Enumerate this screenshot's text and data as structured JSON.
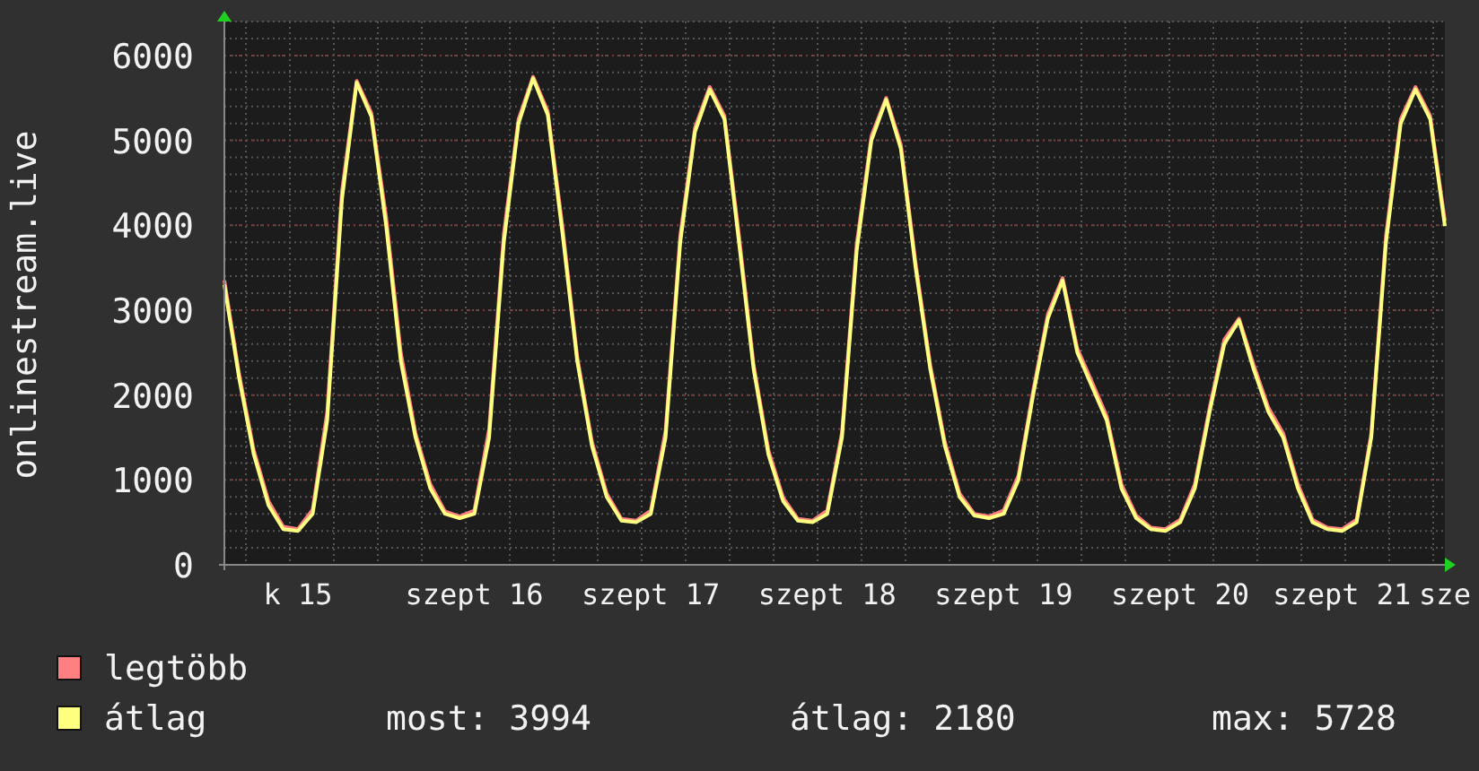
{
  "chart_data": {
    "type": "line",
    "ylabel": "onlinestream.live",
    "grid": true,
    "legend": true,
    "ylim": [
      0,
      6400
    ],
    "yticks": [
      0,
      1000,
      2000,
      3000,
      4000,
      5000,
      6000
    ],
    "categories": [
      null,
      null,
      null,
      null,
      null,
      "k 15",
      null,
      null,
      null,
      null,
      null,
      null,
      null,
      null,
      null,
      null,
      null,
      "szept 16",
      null,
      null,
      null,
      null,
      null,
      null,
      null,
      null,
      null,
      null,
      null,
      "szept 17",
      null,
      null,
      null,
      null,
      null,
      null,
      null,
      null,
      null,
      null,
      null,
      "szept 18",
      null,
      null,
      null,
      null,
      null,
      null,
      null,
      null,
      null,
      null,
      null,
      "szept 19",
      null,
      null,
      null,
      null,
      null,
      null,
      null,
      null,
      null,
      null,
      null,
      "szept 20",
      null,
      null,
      null,
      null,
      null,
      null,
      null,
      null,
      null,
      null,
      "szept 21",
      null,
      null,
      null,
      null,
      null,
      null,
      "sze"
    ],
    "series": [
      {
        "name": "legtöbb",
        "color": "#ff8080",
        "values": [
          3350,
          2250,
          1350,
          750,
          450,
          420,
          650,
          1800,
          4400,
          5700,
          5320,
          4100,
          2500,
          1550,
          950,
          630,
          570,
          640,
          1600,
          3900,
          5250,
          5750,
          5340,
          3980,
          2450,
          1450,
          840,
          540,
          520,
          640,
          1580,
          3880,
          5150,
          5630,
          5290,
          3880,
          2350,
          1350,
          790,
          540,
          520,
          640,
          1560,
          3780,
          5050,
          5500,
          4950,
          3560,
          2350,
          1450,
          840,
          600,
          570,
          640,
          1050,
          2050,
          2950,
          3380,
          2550,
          2150,
          1750,
          950,
          580,
          440,
          420,
          530,
          950,
          1850,
          2650,
          2900,
          2350,
          1850,
          1550,
          950,
          530,
          440,
          420,
          530,
          1550,
          3880,
          5250,
          5630,
          5290,
          4050
        ]
      },
      {
        "name": "átlag",
        "color": "#ffff80",
        "values": [
          3300,
          2200,
          1300,
          700,
          420,
          400,
          600,
          1700,
          4300,
          5680,
          5280,
          4000,
          2400,
          1500,
          900,
          600,
          550,
          600,
          1500,
          3800,
          5200,
          5730,
          5300,
          3900,
          2400,
          1400,
          800,
          520,
          500,
          600,
          1500,
          3800,
          5100,
          5600,
          5250,
          3800,
          2300,
          1300,
          750,
          520,
          500,
          600,
          1500,
          3700,
          5000,
          5480,
          4900,
          3500,
          2300,
          1400,
          800,
          580,
          550,
          600,
          1000,
          2000,
          2900,
          3350,
          2500,
          2100,
          1700,
          900,
          550,
          420,
          400,
          500,
          900,
          1800,
          2600,
          2880,
          2300,
          1800,
          1500,
          900,
          500,
          420,
          400,
          500,
          1500,
          3800,
          5200,
          5600,
          5250,
          3990
        ]
      }
    ]
  },
  "legend_stats": [
    "most: 3994",
    "átlag: 2180",
    "max: 5728"
  ]
}
